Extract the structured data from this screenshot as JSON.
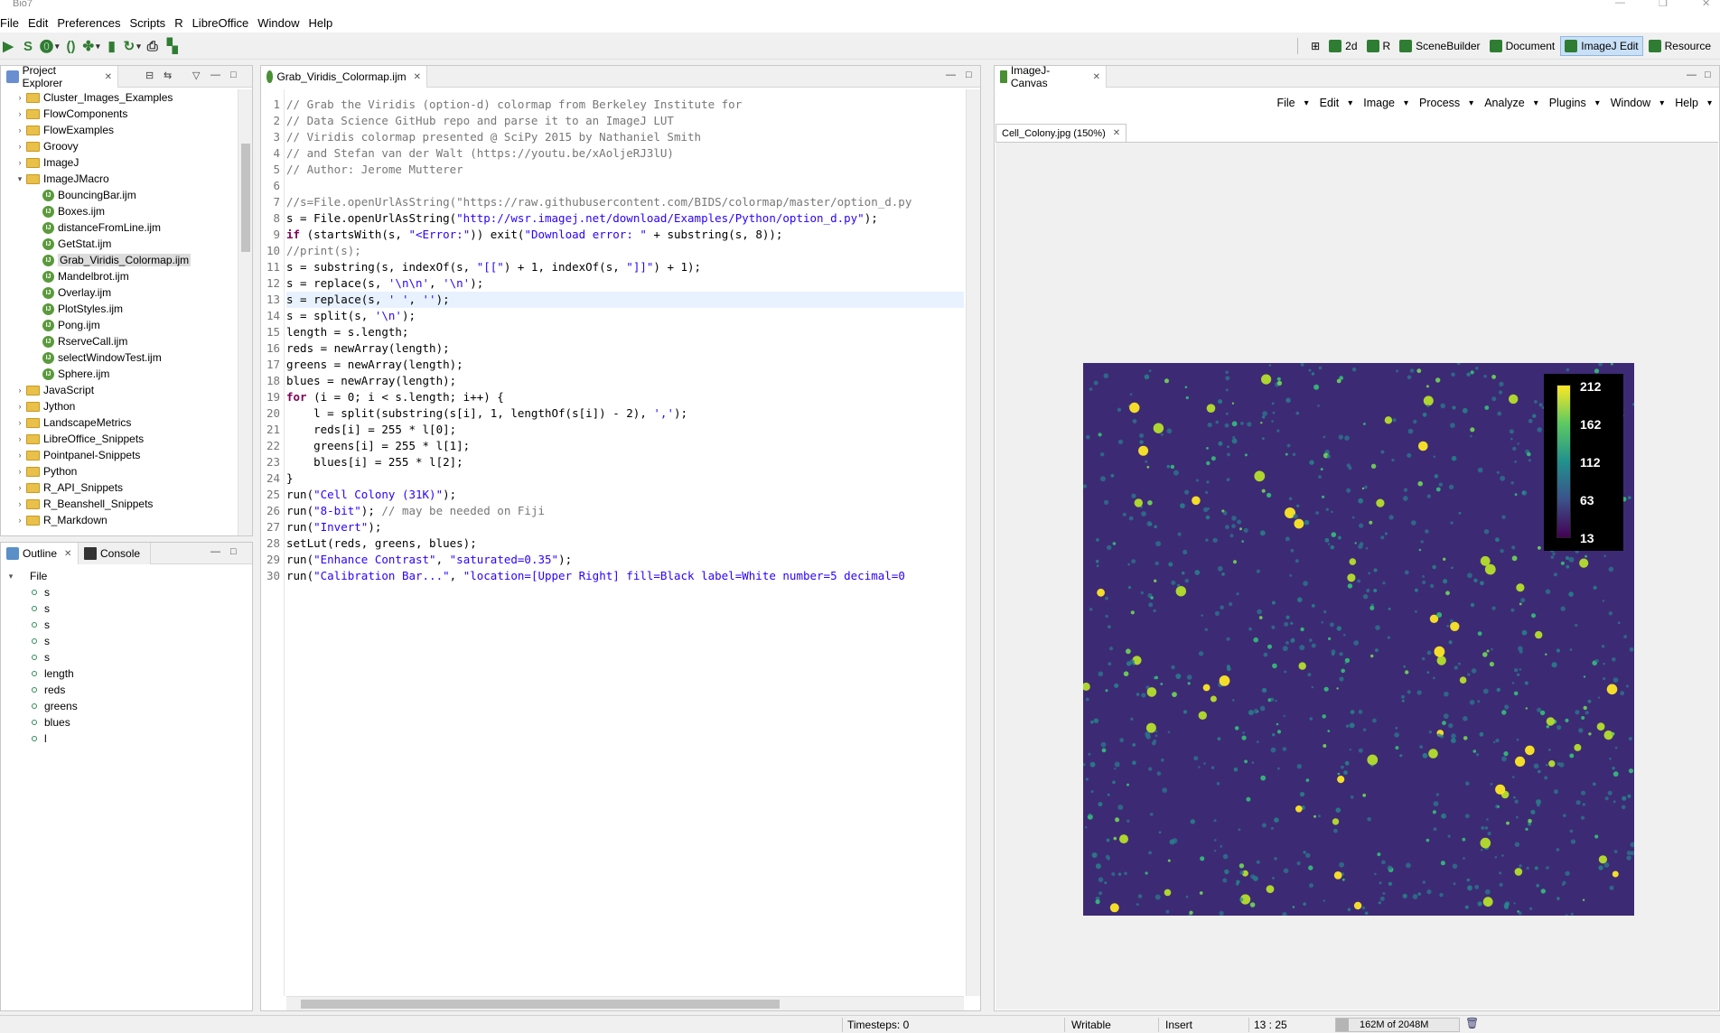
{
  "window": {
    "title": "Bio7"
  },
  "menubar": [
    "File",
    "Edit",
    "Preferences",
    "Scripts",
    "R",
    "LibreOffice",
    "Window",
    "Help"
  ],
  "perspectives": [
    {
      "label": "2d",
      "icon": "grid-icon"
    },
    {
      "label": "R",
      "icon": "r-icon"
    },
    {
      "label": "SceneBuilder",
      "icon": "scenebuilder-icon"
    },
    {
      "label": "Document",
      "icon": "document-icon"
    },
    {
      "label": "ImageJ Edit",
      "icon": "imagej-edit-icon"
    },
    {
      "label": "Resource",
      "icon": "resource-icon"
    }
  ],
  "project_explorer": {
    "tab_label": "Project Explorer",
    "items": [
      {
        "label": "Cluster_Images_Examples",
        "type": "folder",
        "expanded": false
      },
      {
        "label": "FlowComponents",
        "type": "folder",
        "expanded": false
      },
      {
        "label": "FlowExamples",
        "type": "folder",
        "expanded": false
      },
      {
        "label": "Groovy",
        "type": "folder",
        "expanded": false
      },
      {
        "label": "ImageJ",
        "type": "folder",
        "expanded": false
      },
      {
        "label": "ImageJMacro",
        "type": "folder",
        "expanded": true
      },
      {
        "label": "BouncingBar.ijm",
        "type": "file"
      },
      {
        "label": "Boxes.ijm",
        "type": "file"
      },
      {
        "label": "distanceFromLine.ijm",
        "type": "file"
      },
      {
        "label": "GetStat.ijm",
        "type": "file"
      },
      {
        "label": "Grab_Viridis_Colormap.ijm",
        "type": "file",
        "selected": true
      },
      {
        "label": "Mandelbrot.ijm",
        "type": "file"
      },
      {
        "label": "Overlay.ijm",
        "type": "file"
      },
      {
        "label": "PlotStyles.ijm",
        "type": "file"
      },
      {
        "label": "Pong.ijm",
        "type": "file"
      },
      {
        "label": "RserveCall.ijm",
        "type": "file"
      },
      {
        "label": "selectWindowTest.ijm",
        "type": "file"
      },
      {
        "label": "Sphere.ijm",
        "type": "file"
      },
      {
        "label": "JavaScript",
        "type": "folder",
        "expanded": false
      },
      {
        "label": "Jython",
        "type": "folder",
        "expanded": false
      },
      {
        "label": "LandscapeMetrics",
        "type": "folder",
        "expanded": false
      },
      {
        "label": "LibreOffice_Snippets",
        "type": "folder",
        "expanded": false
      },
      {
        "label": "Pointpanel-Snippets",
        "type": "folder",
        "expanded": false
      },
      {
        "label": "Python",
        "type": "folder",
        "expanded": false
      },
      {
        "label": "R_API_Snippets",
        "type": "folder",
        "expanded": false
      },
      {
        "label": "R_Beanshell_Snippets",
        "type": "folder",
        "expanded": false
      },
      {
        "label": "R_Markdown",
        "type": "folder",
        "expanded": false
      }
    ]
  },
  "outline": {
    "tab_label": "Outline",
    "console_label": "Console",
    "root": "File",
    "items": [
      "s",
      "s",
      "s",
      "s",
      "s",
      "length",
      "reds",
      "greens",
      "blues",
      "l"
    ]
  },
  "editor": {
    "tab_label": "Grab_Viridis_Colormap.ijm",
    "current_line": 13,
    "lines": [
      [
        [
          "cm",
          "// Grab the Viridis (option-d) colormap from Berkeley Institute for"
        ]
      ],
      [
        [
          "cm",
          "// Data Science GitHub repo and parse it to an ImageJ LUT"
        ]
      ],
      [
        [
          "cm",
          "// Viridis colormap presented @ SciPy 2015 by Nathaniel Smith"
        ]
      ],
      [
        [
          "cm",
          "// and Stefan van der Walt (https://youtu.be/xAoljeRJ3lU)"
        ]
      ],
      [
        [
          "cm",
          "// Author: Jerome Mutterer"
        ]
      ],
      [
        [
          "",
          ""
        ]
      ],
      [
        [
          "cm",
          "//s=File.openUrlAsString(\"https://raw.githubusercontent.com/BIDS/colormap/master/option_d.py"
        ]
      ],
      [
        [
          "",
          "s = File.openUrlAsString("
        ],
        [
          "st",
          "\"http://wsr.imagej.net/download/Examples/Python/option_d.py\""
        ],
        [
          "",
          ");"
        ]
      ],
      [
        [
          "kw",
          "if"
        ],
        [
          "",
          " (startsWith(s, "
        ],
        [
          "st",
          "\"<Error:\""
        ],
        [
          "",
          ")) exit("
        ],
        [
          "st",
          "\"Download error: \""
        ],
        [
          "",
          " + substring(s, 8));"
        ]
      ],
      [
        [
          "cm",
          "//print(s);"
        ]
      ],
      [
        [
          "",
          "s = substring(s, indexOf(s, "
        ],
        [
          "st",
          "\"[[\""
        ],
        [
          "",
          ") + 1, indexOf(s, "
        ],
        [
          "st",
          "\"]]\""
        ],
        [
          "",
          ") + 1);"
        ]
      ],
      [
        [
          "",
          "s = replace(s, "
        ],
        [
          "st",
          "'\\n\\n'"
        ],
        [
          "",
          ", "
        ],
        [
          "st",
          "'\\n'"
        ],
        [
          "",
          ");"
        ]
      ],
      [
        [
          "",
          "s = replace(s, "
        ],
        [
          "st",
          "' '"
        ],
        [
          "",
          ", "
        ],
        [
          "st",
          "''"
        ],
        [
          "",
          ");"
        ]
      ],
      [
        [
          "",
          "s = split(s, "
        ],
        [
          "st",
          "'\\n'"
        ],
        [
          "",
          ");"
        ]
      ],
      [
        [
          "",
          "length = s.length;"
        ]
      ],
      [
        [
          "",
          "reds = newArray(length);"
        ]
      ],
      [
        [
          "",
          "greens = newArray(length);"
        ]
      ],
      [
        [
          "",
          "blues = newArray(length);"
        ]
      ],
      [
        [
          "kw",
          "for"
        ],
        [
          "",
          " (i = 0; i < s.length; i++) {"
        ]
      ],
      [
        [
          "",
          "    l = split(substring(s[i], 1, lengthOf(s[i]) - 2), "
        ],
        [
          "st",
          "','"
        ],
        [
          "",
          ");"
        ]
      ],
      [
        [
          "",
          "    reds[i] = 255 * l[0];"
        ]
      ],
      [
        [
          "",
          "    greens[i] = 255 * l[1];"
        ]
      ],
      [
        [
          "",
          "    blues[i] = 255 * l[2];"
        ]
      ],
      [
        [
          "",
          "}"
        ]
      ],
      [
        [
          "",
          "run("
        ],
        [
          "st",
          "\"Cell Colony (31K)\""
        ],
        [
          "",
          ");"
        ]
      ],
      [
        [
          "",
          "run("
        ],
        [
          "st",
          "\"8-bit\""
        ],
        [
          "",
          "); "
        ],
        [
          "cm",
          "// may be needed on Fiji"
        ]
      ],
      [
        [
          "",
          "run("
        ],
        [
          "st",
          "\"Invert\""
        ],
        [
          "",
          ");"
        ]
      ],
      [
        [
          "",
          "setLut(reds, greens, blues);"
        ]
      ],
      [
        [
          "",
          "run("
        ],
        [
          "st",
          "\"Enhance Contrast\""
        ],
        [
          "",
          ", "
        ],
        [
          "st",
          "\"saturated=0.35\""
        ],
        [
          "",
          ");"
        ]
      ],
      [
        [
          "",
          "run("
        ],
        [
          "st",
          "\"Calibration Bar...\""
        ],
        [
          "",
          ", "
        ],
        [
          "st",
          "\"location=[Upper Right] fill=Black label=White number=5 decimal=0"
        ]
      ]
    ]
  },
  "canvas": {
    "tab_label": "ImageJ-Canvas",
    "menus": [
      "File",
      "Edit",
      "Image",
      "Process",
      "Analyze",
      "Plugins",
      "Window",
      "Help"
    ],
    "image_tab": "Cell_Colony.jpg (150%)",
    "calibration_labels": [
      "212",
      "162",
      "112",
      "63",
      "13"
    ],
    "colors": {
      "background": "#3d2a74",
      "bar_top": "#fde725",
      "bar_mid": "#21918c",
      "bar_bottom": "#440154",
      "bar_fill": "#000000"
    }
  },
  "statusbar": {
    "timesteps": "Timesteps: 0",
    "writable": "Writable",
    "insert": "Insert",
    "position": "13 : 25",
    "memory": "162M of 2048M"
  }
}
